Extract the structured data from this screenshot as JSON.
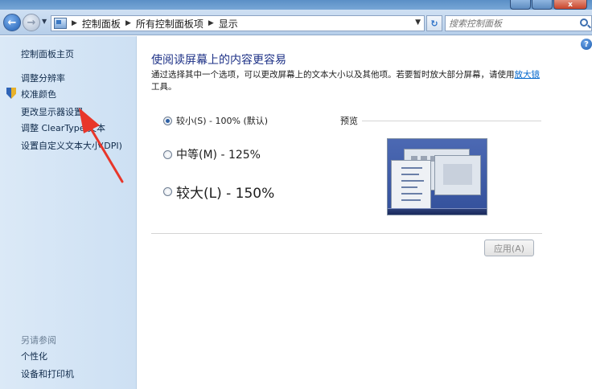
{
  "nav": {
    "breadcrumbs": [
      "控制面板",
      "所有控制面板项",
      "显示"
    ],
    "search_placeholder": "搜索控制面板"
  },
  "window_controls": {
    "close_glyph": "x"
  },
  "sidebar": {
    "home": "控制面板主页",
    "links": [
      "调整分辨率",
      "校准颜色",
      "更改显示器设置",
      "调整 ClearType 文本",
      "设置自定义文本大小(DPI)"
    ],
    "see_also": "另请参阅",
    "see_also_links": [
      "个性化",
      "设备和打印机"
    ]
  },
  "main": {
    "title": "使阅读屏幕上的内容更容易",
    "description": "通过选择其中一个选项，可以更改屏幕上的文本大小以及其他项。若要暂时放大部分屏幕，请使用",
    "magnifier_link": "放大镜",
    "description_tail": "工具。",
    "options": [
      {
        "label": "较小(S) - 100% (默认)",
        "checked": true
      },
      {
        "label": "中等(M) - 125%",
        "checked": false
      },
      {
        "label": "较大(L) - 150%",
        "checked": false
      }
    ],
    "preview_label": "预览",
    "apply_label": "应用(A)"
  },
  "colors": {
    "title_blue": "#1e3287",
    "link_blue": "#0066cc",
    "annotation_red": "#e8362a",
    "sidebar_bg": "#d4e5f6"
  }
}
